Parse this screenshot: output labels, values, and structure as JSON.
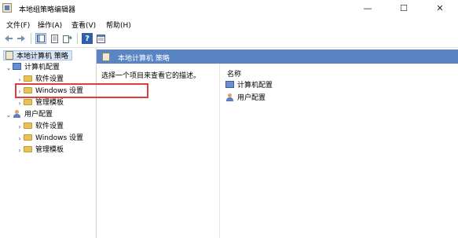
{
  "window": {
    "title": "本地组策略编辑器",
    "buttons": {
      "minimize": "—",
      "maximize": "☐",
      "close": "✕"
    }
  },
  "menu": [
    "文件(F)",
    "操作(A)",
    "查看(V)",
    "帮助(H)"
  ],
  "toolbar": {
    "icons": [
      "back-icon",
      "forward-icon",
      "show-hide-tree-icon",
      "export-list-icon",
      "help-icon",
      "properties-icon"
    ]
  },
  "tree": {
    "root": "本地计算机 策略",
    "computer": {
      "label": "计算机配置",
      "children": [
        "软件设置",
        "Windows 设置",
        "管理模板"
      ]
    },
    "user": {
      "label": "用户配置",
      "children": [
        "软件设置",
        "Windows 设置",
        "管理模板"
      ]
    }
  },
  "right": {
    "header": "本地计算机 策略",
    "description": "选择一个项目来查看它的描述。",
    "column": "名称",
    "items": [
      "计算机配置",
      "用户配置"
    ]
  }
}
